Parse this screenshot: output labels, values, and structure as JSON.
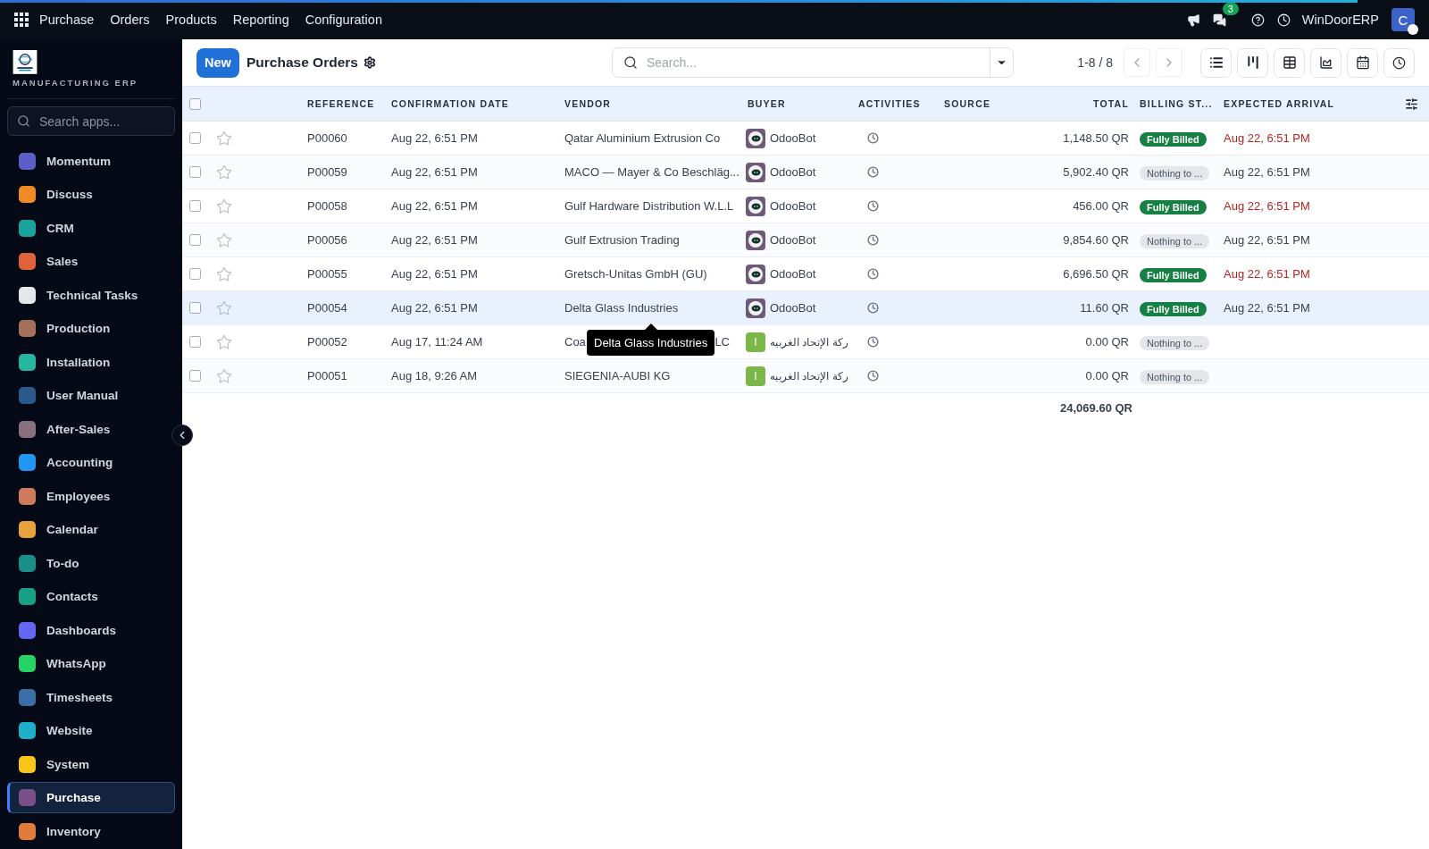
{
  "topbar": {
    "app": "Purchase",
    "menu": [
      "Orders",
      "Products",
      "Reporting",
      "Configuration"
    ],
    "chat_count": "3",
    "company": "WinDoorERP",
    "avatar": "C"
  },
  "sidebar": {
    "brand": "MANUFACTURING ERP",
    "search_placeholder": "Search apps...",
    "items": [
      {
        "label": "Momentum",
        "color": "#5b5fc7",
        "selected": false
      },
      {
        "label": "Discuss",
        "color": "#f08a24",
        "selected": false
      },
      {
        "label": "CRM",
        "color": "#1aa39a",
        "selected": false
      },
      {
        "label": "Sales",
        "color": "#e0613a",
        "selected": false
      },
      {
        "label": "Technical Tasks",
        "color": "#e5e7eb",
        "selected": false
      },
      {
        "label": "Production",
        "color": "#a3705c",
        "selected": false
      },
      {
        "label": "Installation",
        "color": "#26b5a0",
        "selected": false
      },
      {
        "label": "User Manual",
        "color": "#2a5a8a",
        "selected": false
      },
      {
        "label": "After-Sales",
        "color": "#8a6f7f",
        "selected": false
      },
      {
        "label": "Accounting",
        "color": "#2196f3",
        "selected": false
      },
      {
        "label": "Employees",
        "color": "#d07a5c",
        "selected": false
      },
      {
        "label": "Calendar",
        "color": "#e6a23c",
        "selected": false
      },
      {
        "label": "To-do",
        "color": "#1a8f8a",
        "selected": false
      },
      {
        "label": "Contacts",
        "color": "#16a085",
        "selected": false
      },
      {
        "label": "Dashboards",
        "color": "#6366f1",
        "selected": false
      },
      {
        "label": "WhatsApp",
        "color": "#25d366",
        "selected": false
      },
      {
        "label": "Timesheets",
        "color": "#3b6ea5",
        "selected": false
      },
      {
        "label": "Website",
        "color": "#1eb0c8",
        "selected": false
      },
      {
        "label": "System",
        "color": "#f5c518",
        "selected": false
      },
      {
        "label": "Purchase",
        "color": "#7b4f8a",
        "selected": true
      },
      {
        "label": "Inventory",
        "color": "#e07b39",
        "selected": false
      }
    ]
  },
  "control_panel": {
    "new_button": "New",
    "title": "Purchase Orders",
    "search_placeholder": "Search...",
    "pager": "1-8 / 8"
  },
  "table": {
    "select_all": {
      "checked": false
    },
    "columns": [
      "REFERENCE",
      "CONFIRMATION DATE",
      "VENDOR",
      "BUYER",
      "ACTIVITIES",
      "SOURCE",
      "TOTAL",
      "BILLING ST...",
      "EXPECTED ARRIVAL"
    ],
    "rows": [
      {
        "checked": false,
        "reference": "P00060",
        "date": "Aug 22, 6:51 PM",
        "vendor": "Qatar Aluminium Extrusion Co",
        "buyer_avatar": {
          "kind": "bot"
        },
        "buyer": "OdooBot",
        "total": "1,148.50 QR",
        "billing": {
          "label": "Fully Billed",
          "kind": "billed"
        },
        "arrival": "Aug 22, 6:51 PM",
        "late": true,
        "highlighted": false
      },
      {
        "checked": false,
        "reference": "P00059",
        "date": "Aug 22, 6:51 PM",
        "vendor": "MACO — Mayer & Co Beschläg...",
        "buyer_avatar": {
          "kind": "bot"
        },
        "buyer": "OdooBot",
        "total": "5,902.40 QR",
        "billing": {
          "label": "Nothing to ...",
          "kind": "nothing"
        },
        "arrival": "Aug 22, 6:51 PM",
        "late": false,
        "highlighted": false
      },
      {
        "checked": false,
        "reference": "P00058",
        "date": "Aug 22, 6:51 PM",
        "vendor": "Gulf Hardware Distribution W.L.L",
        "buyer_avatar": {
          "kind": "bot"
        },
        "buyer": "OdooBot",
        "total": "456.00 QR",
        "billing": {
          "label": "Fully Billed",
          "kind": "billed"
        },
        "arrival": "Aug 22, 6:51 PM",
        "late": true,
        "highlighted": false
      },
      {
        "checked": false,
        "reference": "P00056",
        "date": "Aug 22, 6:51 PM",
        "vendor": "Gulf Extrusion Trading",
        "buyer_avatar": {
          "kind": "bot"
        },
        "buyer": "OdooBot",
        "total": "9,854.60 QR",
        "billing": {
          "label": "Nothing to ...",
          "kind": "nothing"
        },
        "arrival": "Aug 22, 6:51 PM",
        "late": false,
        "highlighted": false
      },
      {
        "checked": false,
        "reference": "P00055",
        "date": "Aug 22, 6:51 PM",
        "vendor": "Gretsch-Unitas GmbH (GU)",
        "buyer_avatar": {
          "kind": "bot"
        },
        "buyer": "OdooBot",
        "total": "6,696.50 QR",
        "billing": {
          "label": "Fully Billed",
          "kind": "billed"
        },
        "arrival": "Aug 22, 6:51 PM",
        "late": true,
        "highlighted": false
      },
      {
        "checked": false,
        "reference": "P00054",
        "date": "Aug 22, 6:51 PM",
        "vendor": "Delta Glass Industries",
        "buyer_avatar": {
          "kind": "bot"
        },
        "buyer": "OdooBot",
        "total": "11.60 QR",
        "billing": {
          "label": "Fully Billed",
          "kind": "billed"
        },
        "arrival": "Aug 22, 6:51 PM",
        "late": false,
        "highlighted": true
      },
      {
        "checked": false,
        "reference": "P00052",
        "date": "Aug 17, 11:24 AM",
        "vendor": "Coa",
        "vendor_tail": "LC",
        "buyer_avatar": {
          "kind": "letter",
          "letter": "I"
        },
        "buyer": "ركة الإتحاد الغربيه",
        "total": "0.00 QR",
        "billing": {
          "label": "Nothing to ...",
          "kind": "nothing"
        },
        "highlighted": false
      },
      {
        "checked": false,
        "reference": "P00051",
        "date": "Aug 18, 9:26 AM",
        "vendor": "SIEGENIA-AUBI KG",
        "buyer_avatar": {
          "kind": "letter",
          "letter": "I"
        },
        "buyer": "ركة الإتحاد الغربيه",
        "total": "0.00 QR",
        "billing": {
          "label": "Nothing to ...",
          "kind": "nothing"
        },
        "highlighted": false
      }
    ],
    "total": "24,069.60 QR"
  },
  "tooltip": "Delta Glass Industries"
}
